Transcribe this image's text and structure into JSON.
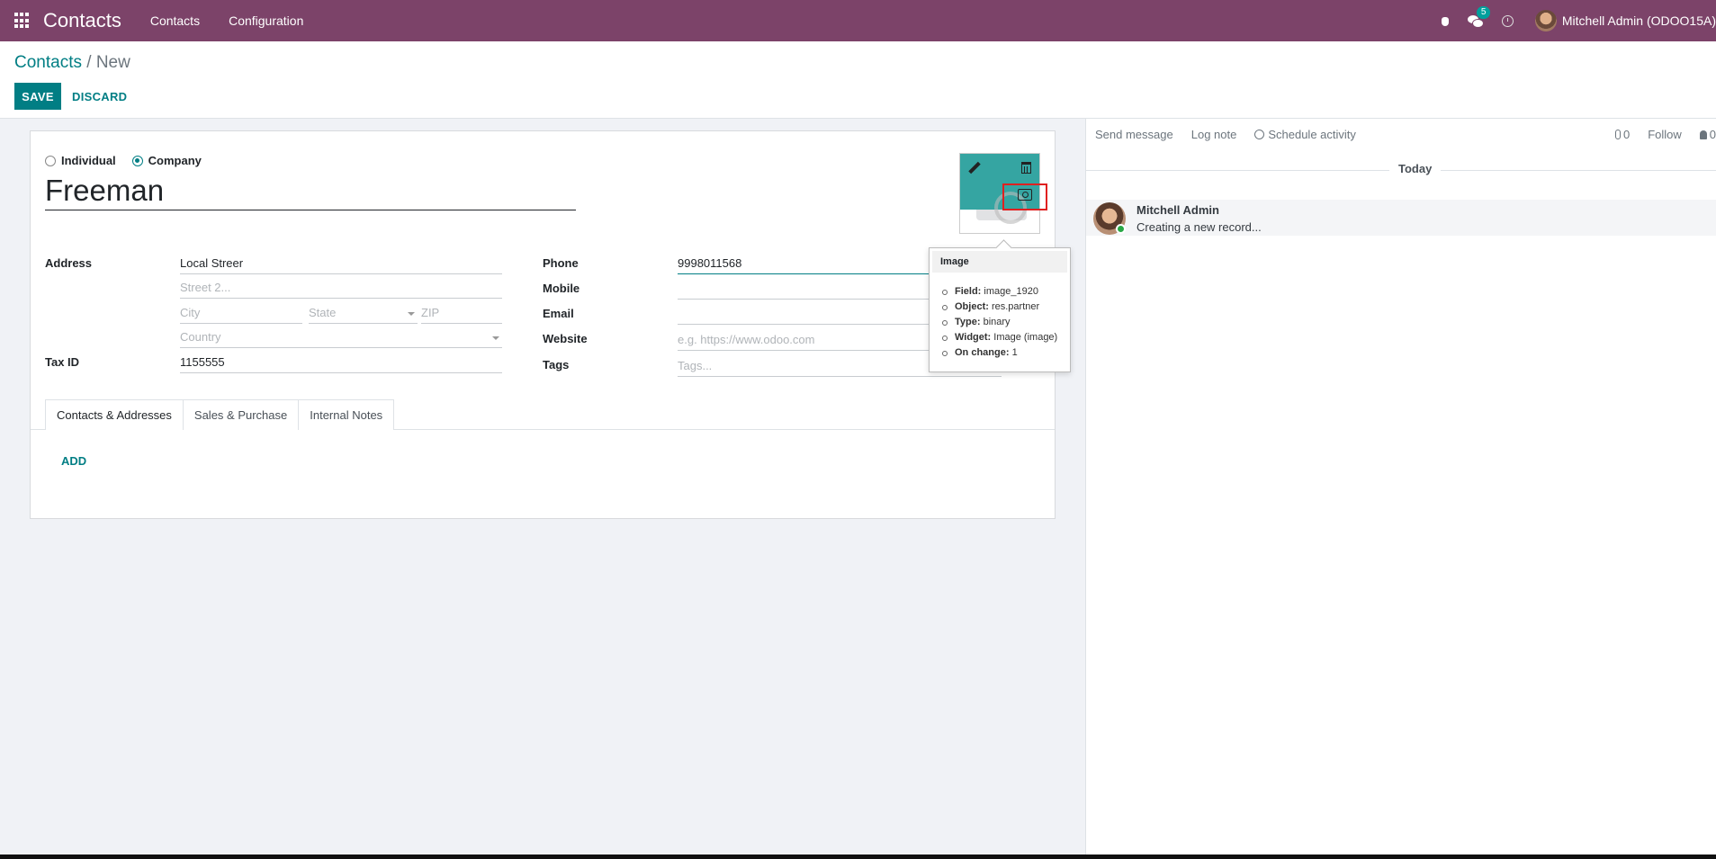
{
  "navbar": {
    "app_name": "Contacts",
    "menu_contacts": "Contacts",
    "menu_configuration": "Configuration",
    "chat_badge": "5",
    "user": "Mitchell Admin (ODOO15A)"
  },
  "control": {
    "breadcrumb_parent": "Contacts",
    "breadcrumb_sep": "/",
    "breadcrumb_current": "New",
    "save_label": "SAVE",
    "discard_label": "DISCARD"
  },
  "form": {
    "type_individual": "Individual",
    "type_company": "Company",
    "company_type_selected": "Company",
    "name": "Freeman",
    "address_label": "Address",
    "street": "Local Streer",
    "street2_placeholder": "Street 2...",
    "city_placeholder": "City",
    "state_placeholder": "State",
    "zip_placeholder": "ZIP",
    "country_placeholder": "Country",
    "tax_id_label": "Tax ID",
    "tax_id": "1155555",
    "phone_label": "Phone",
    "phone": "9998011568",
    "mobile_label": "Mobile",
    "mobile": "",
    "email_label": "Email",
    "email": "",
    "website_label": "Website",
    "website_placeholder": "e.g. https://www.odoo.com",
    "tags_label": "Tags",
    "tags_placeholder": "Tags..."
  },
  "tabs": [
    {
      "label": "Contacts & Addresses"
    },
    {
      "label": "Sales & Purchase"
    },
    {
      "label": "Internal Notes"
    }
  ],
  "add_label": "ADD",
  "tooltip": {
    "title": "Image",
    "items": [
      {
        "key": "Field:",
        "value": "image_1920"
      },
      {
        "key": "Object:",
        "value": "res.partner"
      },
      {
        "key": "Type:",
        "value": "binary"
      },
      {
        "key": "Widget:",
        "value": "Image (image)"
      },
      {
        "key": "On change:",
        "value": "1"
      }
    ]
  },
  "chatter": {
    "send_message": "Send message",
    "log_note": "Log note",
    "schedule_activity": "Schedule activity",
    "attachments_count": "0",
    "follow": "Follow",
    "followers_count": "0",
    "today": "Today",
    "message_author": "Mitchell Admin",
    "message_body": "Creating a new record..."
  },
  "colors": {
    "navbar": "#7c4369",
    "primary": "#017e84",
    "highlight": "#e02020"
  }
}
